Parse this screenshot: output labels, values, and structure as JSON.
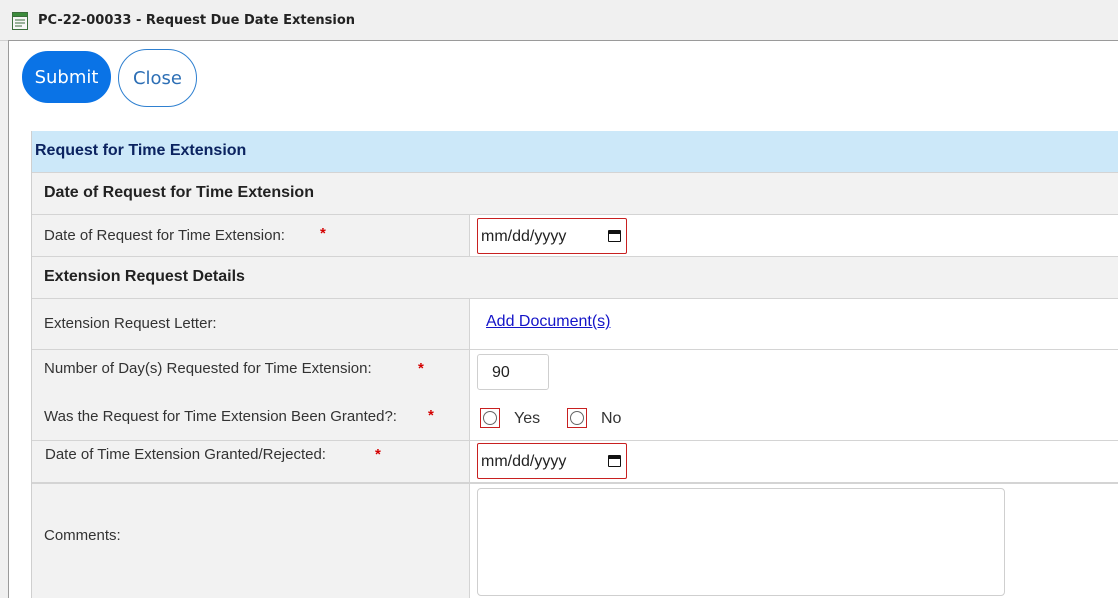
{
  "window": {
    "title": "PC-22-00033 - Request Due Date Extension"
  },
  "toolbar": {
    "submit_label": "Submit",
    "close_label": "Close"
  },
  "form": {
    "header": "Request for Time Extension",
    "section1": {
      "title": "Date of Request for Time Extension"
    },
    "date_request": {
      "label": "Date of Request for Time Extension:",
      "required": "*",
      "placeholder": "mm/dd/yyyy"
    },
    "section2": {
      "title": "Extension Request Details"
    },
    "letter": {
      "label": "Extension Request Letter:",
      "link": "Add Document(s)"
    },
    "days": {
      "label": "Number of Day(s) Requested for Time Extension:",
      "required": "*",
      "value": "90"
    },
    "granted": {
      "label": "Was the Request for Time Extension Been Granted?:",
      "required": "*",
      "options": [
        "Yes",
        "No"
      ]
    },
    "date_granted": {
      "label": "Date of Time Extension Granted/Rejected:",
      "required": "*",
      "placeholder": "mm/dd/yyyy"
    },
    "comments": {
      "label": "Comments:"
    }
  },
  "colors": {
    "accent": "#0a73e6",
    "header_bg": "#cce8f9",
    "required": "#d40000",
    "link": "#1414c8"
  }
}
